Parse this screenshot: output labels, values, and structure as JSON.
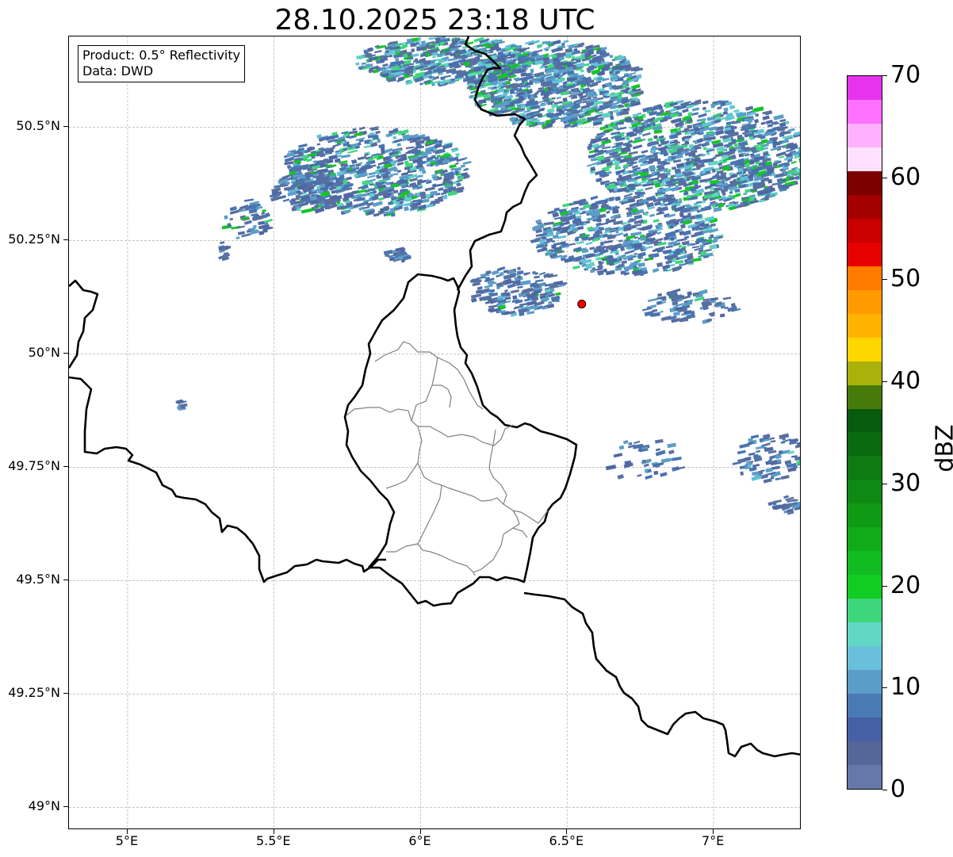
{
  "title": "28.10.2025 23:18 UTC",
  "info": {
    "product_line": "Product: 0.5° Reflectivity",
    "data_line": "Data: DWD"
  },
  "axes": {
    "x_ticks": [
      "5°E",
      "5.5°E",
      "6°E",
      "6.5°E",
      "7°E"
    ],
    "y_ticks": [
      "50.5°N",
      "50.25°N",
      "50°N",
      "49.75°N",
      "49.5°N",
      "49.25°N",
      "49°N"
    ],
    "lon_range": [
      4.8,
      7.3
    ],
    "lat_range": [
      48.95,
      50.7
    ]
  },
  "colorbar": {
    "label": "dBZ",
    "ticks": [
      "0",
      "10",
      "20",
      "30",
      "40",
      "50",
      "60",
      "70"
    ],
    "range": [
      0,
      70
    ],
    "colors": [
      "#6677aa",
      "#556699",
      "#4560a5",
      "#4a7ab5",
      "#5a9ec8",
      "#68c0dc",
      "#62d8c4",
      "#3ed67a",
      "#11cc22",
      "#11bb22",
      "#11aa18",
      "#0f9a15",
      "#0e8a14",
      "#0d7a12",
      "#0a6a10",
      "#085a0d",
      "#467a0a",
      "#aab10a",
      "#ffd700",
      "#ffb300",
      "#ff9a00",
      "#ff7c00",
      "#e60000",
      "#c80000",
      "#a40000",
      "#7c0000",
      "#ffe0ff",
      "#ffb0ff",
      "#ff70ff",
      "#e833ee"
    ]
  },
  "marker": {
    "lon": 6.55,
    "lat": 50.11,
    "color": "#ff0000"
  },
  "grid": true
}
